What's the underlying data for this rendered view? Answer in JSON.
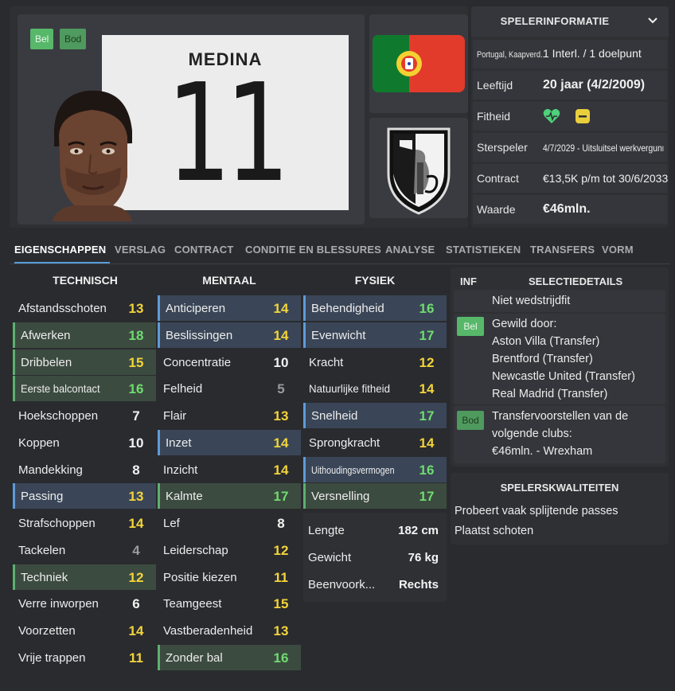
{
  "player": {
    "name": "MEDINA",
    "number": "11",
    "tags": [
      "Bel",
      "Bod"
    ]
  },
  "info": {
    "title": "SPELERINFORMATIE",
    "rows": [
      {
        "label": "Portugal, Kaapverd...",
        "value": "1 Interl. / 1 doelpunt"
      },
      {
        "label": "Leeftijd",
        "value": "20 jaar (4/2/2009)"
      },
      {
        "label": "Fitheid",
        "value": ""
      },
      {
        "label": "Sterspeler",
        "value": "4/7/2029 - Uitsluitsel werkvergunnin..."
      },
      {
        "label": "Contract",
        "value": "€13,5K p/m tot 30/6/2033"
      },
      {
        "label": "Waarde",
        "value": "€46mln."
      }
    ]
  },
  "tabs": [
    "EIGENSCHAPPEN",
    "VERSLAG",
    "CONTRACT",
    "CONDITIE EN BLESSURES",
    "ANALYSE",
    "STATISTIEKEN",
    "TRANSFERS",
    "VORM"
  ],
  "columns": {
    "technisch": {
      "title": "TECHNISCH",
      "attrs": [
        {
          "name": "Afstandsschoten",
          "value": "13"
        },
        {
          "name": "Afwerken",
          "value": "18"
        },
        {
          "name": "Dribbelen",
          "value": "15"
        },
        {
          "name": "Eerste balcontact",
          "value": "16"
        },
        {
          "name": "Hoekschoppen",
          "value": "7"
        },
        {
          "name": "Koppen",
          "value": "10"
        },
        {
          "name": "Mandekking",
          "value": "8"
        },
        {
          "name": "Passing",
          "value": "13"
        },
        {
          "name": "Strafschoppen",
          "value": "14"
        },
        {
          "name": "Tackelen",
          "value": "4"
        },
        {
          "name": "Techniek",
          "value": "12"
        },
        {
          "name": "Verre inworpen",
          "value": "6"
        },
        {
          "name": "Voorzetten",
          "value": "14"
        },
        {
          "name": "Vrije trappen",
          "value": "11"
        }
      ]
    },
    "mentaal": {
      "title": "MENTAAL",
      "attrs": [
        {
          "name": "Anticiperen",
          "value": "14"
        },
        {
          "name": "Beslissingen",
          "value": "14"
        },
        {
          "name": "Concentratie",
          "value": "10"
        },
        {
          "name": "Felheid",
          "value": "5"
        },
        {
          "name": "Flair",
          "value": "13"
        },
        {
          "name": "Inzet",
          "value": "14"
        },
        {
          "name": "Inzicht",
          "value": "14"
        },
        {
          "name": "Kalmte",
          "value": "17"
        },
        {
          "name": "Lef",
          "value": "8"
        },
        {
          "name": "Leiderschap",
          "value": "12"
        },
        {
          "name": "Positie kiezen",
          "value": "11"
        },
        {
          "name": "Teamgeest",
          "value": "15"
        },
        {
          "name": "Vastberadenheid",
          "value": "13"
        },
        {
          "name": "Zonder bal",
          "value": "16"
        }
      ]
    },
    "fysiek": {
      "title": "FYSIEK",
      "attrs": [
        {
          "name": "Behendigheid",
          "value": "16"
        },
        {
          "name": "Evenwicht",
          "value": "17"
        },
        {
          "name": "Kracht",
          "value": "12"
        },
        {
          "name": "Natuurlijke fitheid",
          "value": "14"
        },
        {
          "name": "Snelheid",
          "value": "17"
        },
        {
          "name": "Sprongkracht",
          "value": "14"
        },
        {
          "name": "Uithoudingsvermogen",
          "value": "16"
        },
        {
          "name": "Versnelling",
          "value": "17"
        }
      ],
      "physical": [
        {
          "name": "Lengte",
          "value": "182 cm"
        },
        {
          "name": "Gewicht",
          "value": "76 kg"
        },
        {
          "name": "Beenvoork...",
          "value": "Rechts"
        }
      ]
    }
  },
  "selection": {
    "inf_label": "INF",
    "title": "SELECTIEDETAILS",
    "status": "Niet wedstrijdfit",
    "wanted_tag": "Bel",
    "wanted_lines": [
      "Gewild door:",
      "Aston Villa (Transfer)",
      "Brentford (Transfer)",
      "Newcastle United (Transfer)",
      "Real Madrid (Transfer)"
    ],
    "offers_tag": "Bod",
    "offers_lines": [
      "Transfervoorstellen van de",
      "volgende clubs:",
      "€46mln. - Wrexham"
    ]
  },
  "qualities": {
    "title": "SPELERSKWALITEITEN",
    "items": [
      "Probeert vaak splijtende passes",
      "Plaatst schoten"
    ]
  },
  "colors": {
    "accent_blue": "#5e9bd8",
    "accent_green": "#5cb070",
    "value_yellow": "#f3d43a",
    "value_green": "#6fdc6f"
  }
}
